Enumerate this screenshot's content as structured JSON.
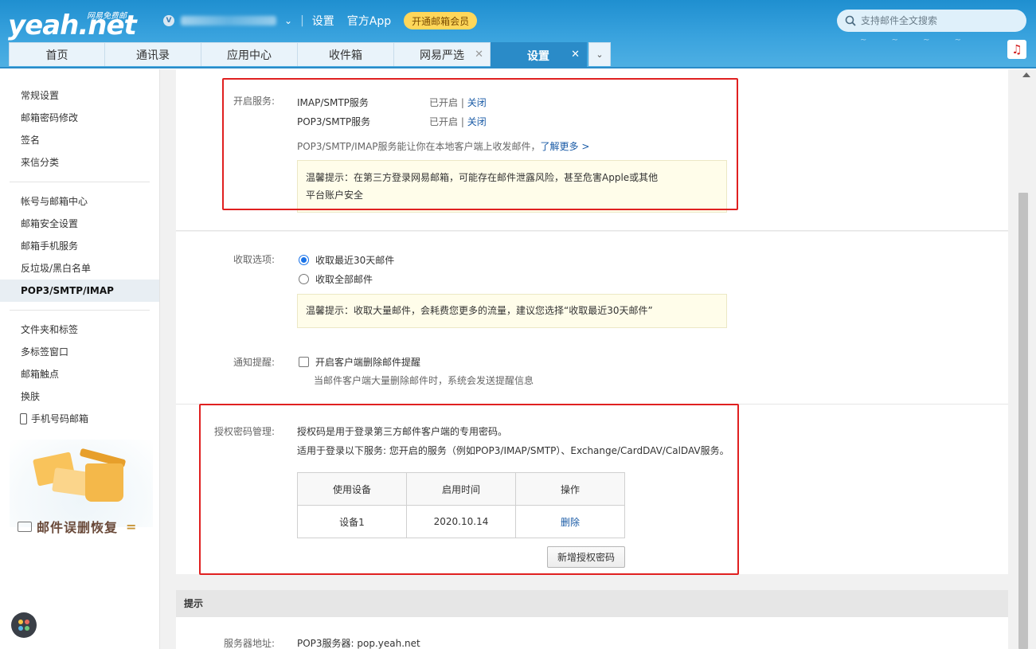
{
  "header": {
    "logo_main": "yeah.net",
    "logo_sub": "网易免费邮",
    "user_badge": "V",
    "links": [
      "设置",
      "官方App"
    ],
    "vip_button": "开通邮箱会员",
    "search_placeholder": "支持邮件全文搜索"
  },
  "tabs": [
    {
      "label": "首页",
      "closable": false,
      "active": false
    },
    {
      "label": "通讯录",
      "closable": false,
      "active": false
    },
    {
      "label": "应用中心",
      "closable": false,
      "active": false
    },
    {
      "label": "收件箱",
      "closable": false,
      "active": false
    },
    {
      "label": "网易严选",
      "closable": true,
      "active": false
    },
    {
      "label": "设置",
      "closable": true,
      "active": true
    }
  ],
  "sidebar": {
    "group1": [
      "常规设置",
      "邮箱密码修改",
      "签名",
      "来信分类"
    ],
    "group2": [
      "帐号与邮箱中心",
      "邮箱安全设置",
      "邮箱手机服务",
      "反垃圾/黑白名单",
      "POP3/SMTP/IMAP"
    ],
    "group3": [
      "文件夹和标签",
      "多标签窗口",
      "邮箱触点",
      "换肤"
    ],
    "phone_item": "手机号码邮箱",
    "active": "POP3/SMTP/IMAP",
    "recover_text": "邮件误删恢复",
    "recover_suffix": "="
  },
  "services": {
    "label": "开启服务:",
    "rows": [
      {
        "name": "IMAP/SMTP服务",
        "status": "已开启",
        "sep": "|",
        "action": "关闭"
      },
      {
        "name": "POP3/SMTP服务",
        "status": "已开启",
        "sep": "|",
        "action": "关闭"
      }
    ],
    "desc": "POP3/SMTP/IMAP服务能让你在本地客户端上收发邮件，",
    "learn_more": "了解更多 >",
    "tip_line1": "温馨提示：在第三方登录网易邮箱，可能存在邮件泄露风险，甚至危害Apple或其他",
    "tip_line2": "平台账户安全"
  },
  "receive": {
    "label": "收取选项:",
    "options": [
      "收取最近30天邮件",
      "收取全部邮件"
    ],
    "selected": 0,
    "tip": "温馨提示：收取大量邮件，会耗费您更多的流量，建议您选择“收取最近30天邮件”"
  },
  "notify": {
    "label": "通知提醒:",
    "checkbox_label": "开启客户端删除邮件提醒",
    "checked": false,
    "desc": "当邮件客户端大量删除邮件时，系统会发送提醒信息"
  },
  "auth": {
    "label": "授权密码管理:",
    "line1": "授权码是用于登录第三方邮件客户端的专用密码。",
    "line2": "适用于登录以下服务: 您开启的服务（例如POP3/IMAP/SMTP）、Exchange/CardDAV/CalDAV服务。",
    "table": {
      "headers": [
        "使用设备",
        "启用时间",
        "操作"
      ],
      "rows": [
        [
          "设备1",
          "2020.10.14",
          "删除"
        ]
      ]
    },
    "new_button": "新增授权密码"
  },
  "hint": {
    "title": "提示",
    "server_label": "服务器地址:",
    "server_value": "POP3服务器: pop.yeah.net"
  },
  "colors": {
    "header_blue": "#2a8bc8",
    "highlight_red": "#e02020",
    "link_blue": "#1a5ba6",
    "tip_bg": "#fffdea",
    "vip_yellow": "#ffd75a"
  }
}
